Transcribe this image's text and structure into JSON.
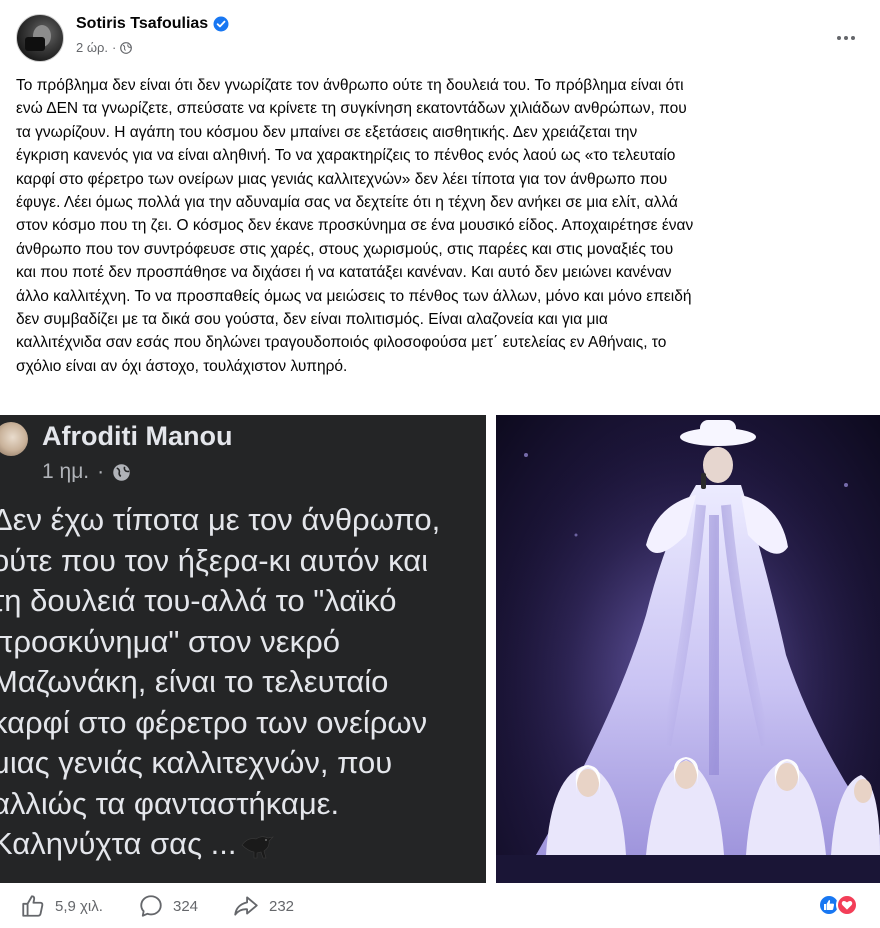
{
  "post": {
    "author": "Sotiris Tsafoulias",
    "verified": true,
    "time": "2 ώρ.",
    "separator": "·",
    "audience_icon": "globe-icon",
    "more_icon": "more-options-icon",
    "text_lines": [
      "Το πρόβλημα δεν είναι ότι δεν γνωρίζατε τον άνθρωπο ούτε τη δουλειά του. Το πρόβλημα είναι ότι",
      "ενώ ΔΕΝ τα γνωρίζετε, σπεύσατε  να κρίνετε τη συγκίνηση εκατοντάδων χιλιάδων ανθρώπων, που",
      "τα γνωρίζουν. Η αγάπη του κόσμου δεν μπαίνει σε εξετάσεις αισθητικής. Δεν χρειάζεται την",
      "έγκριση κανενός για να είναι αληθινή. Το να χαρακτηρίζεις το πένθος ενός λαού ως «το τελευταίο",
      "καρφί στο φέρετρο των ονείρων μιας γενιάς καλλιτεχνών» δεν λέει τίποτα για τον άνθρωπο που",
      "έφυγε. Λέει όμως πολλά για την αδυναμία σας να δεχτείτε ότι η τέχνη δεν ανήκει σε μια ελίτ, αλλά",
      "στον κόσμο που τη ζει. Ο κόσμος δεν έκανε προσκύνημα σε ένα μουσικό είδος. Αποχαιρέτησε έναν",
      "άνθρωπο που τον συντρόφευσε στις χαρές, στους χωρισμούς, στις παρέες και στις μοναξιές του",
      "και που ποτέ δεν προσπάθησε να διχάσει ή να κατατάξει κανέναν.  Και αυτό δεν μειώνει κανέναν",
      "άλλο καλλιτέχνη. Το να προσπαθείς όμως να μειώσεις το πένθος των άλλων, μόνο και μόνο επειδή",
      "δεν συμβαδίζει με τα δικά σου γούστα, δεν είναι πολιτισμός. Είναι αλαζονεία και για μια",
      "καλλιτέχνιδα σαν εσάς που δηλώνει τραγουδοποιός φιλοσοφούσα μετ΄ ευτελείας εν Αθήναις, το",
      "σχόλιο είναι αν όχι άστοχο, τουλάχιστον λυπηρό."
    ]
  },
  "screenshot": {
    "author": "Afroditi Manou",
    "time": "1 ημ.",
    "separator": "·",
    "audience_icon": "globe-icon",
    "text_lines": [
      "Δεν έχω τίποτα με τον άνθρωπο,",
      "ούτε που τον ήξερα-κι αυτόν και",
      "τη δουλειά του-αλλά το \"λαϊκό",
      "προσκύνημα\" στον νεκρό",
      "Μαζωνάκη, είναι το τελευταίο",
      "καρφί στο φέρετρο των ονείρων",
      "μιας γενιάς καλλιτεχνών, που",
      "αλλιώς τα φανταστήκαμε.",
      "Καληνύχτα σας ..."
    ],
    "emoji_icon": "crow-icon"
  },
  "photo": {
    "description_icon": "stage-performer-photo"
  },
  "stats": {
    "likes": "5,9 χιλ.",
    "comments": "324",
    "shares": "232",
    "reaction_icons": [
      "like-reaction-icon",
      "love-reaction-icon"
    ]
  },
  "colors": {
    "text": "#050505",
    "secondary": "#65676b",
    "verified": "#1877f2",
    "dark_card": "#242526",
    "love": "#f33e58"
  }
}
